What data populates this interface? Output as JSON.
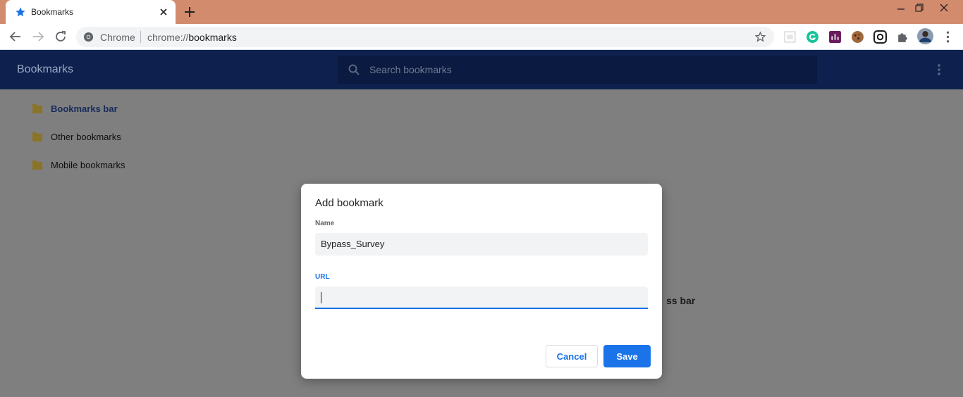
{
  "tab": {
    "title": "Bookmarks"
  },
  "omnibox": {
    "site_label": "Chrome",
    "url_prefix": "chrome://",
    "url_path": "bookmarks"
  },
  "extensions": [
    "reader-icon",
    "grammarly-icon",
    "analytics-icon",
    "cookie-icon",
    "vpn-icon",
    "puzzle-icon",
    "profile-avatar"
  ],
  "header": {
    "title": "Bookmarks",
    "search_placeholder": "Search bookmarks"
  },
  "sidebar": {
    "items": [
      {
        "label": "Bookmarks bar",
        "selected": true
      },
      {
        "label": "Other bookmarks",
        "selected": false
      },
      {
        "label": "Mobile bookmarks",
        "selected": false
      }
    ]
  },
  "background_text": "ss bar",
  "dialog": {
    "title": "Add bookmark",
    "name_label": "Name",
    "name_value": "Bypass_Survey",
    "url_label": "URL",
    "url_value": "",
    "cancel_label": "Cancel",
    "save_label": "Save"
  },
  "colors": {
    "accent": "#1a73e8",
    "titlebar": "#d38b6e",
    "header": "#0e214e"
  }
}
